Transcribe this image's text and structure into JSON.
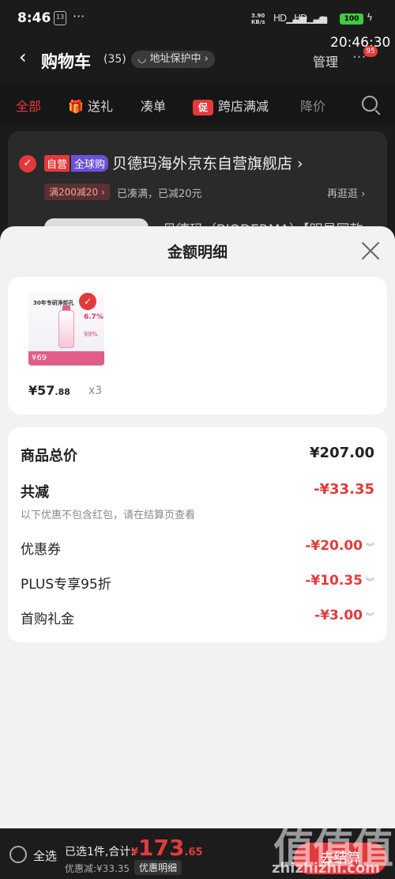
{
  "status_bar": {
    "time": "8:46",
    "notif_icon": "13",
    "more": "···",
    "speed_value": "3.90",
    "speed_unit": "KB/s",
    "signal1": "HD",
    "signal2": "HD",
    "battery": "100"
  },
  "clock_overlay": "20:46:30",
  "header": {
    "back_icon": "‹",
    "title": "购物车",
    "count": "(35)",
    "address": "地址保护中",
    "manage": "管理",
    "more_icon": "···",
    "badge": "95"
  },
  "tabs": [
    {
      "label": "全部",
      "active": true
    },
    {
      "label": "送礼",
      "icon": "gift-icon"
    },
    {
      "label": "凑单"
    },
    {
      "label": "跨店满减",
      "tag": "促"
    },
    {
      "label": "降价"
    }
  ],
  "shop": {
    "tag_self": "自营",
    "tag_global": "全球购",
    "name": "贝德玛海外京东自营旗舰店",
    "promo": "满200减20",
    "promo_status": "已凑满，已减20元",
    "more": "再逛逛",
    "product_title": "贝德玛（BIODERMA）【明星同款"
  },
  "sheet": {
    "title": "金额明细",
    "product": {
      "image_header": "30年专研净卸孔",
      "image_pct1": "6.7%",
      "image_pct2": "99%",
      "image_price": "69",
      "price_int": "¥57",
      "price_dec": ".88",
      "qty": "x3"
    },
    "summary": {
      "total_label": "商品总价",
      "total_value": "¥207.00",
      "reduce_label": "共减",
      "reduce_value": "-¥33.35",
      "note": "以下优惠不包含红包，请在结算页查看",
      "items": [
        {
          "label": "优惠券",
          "value": "-¥20.00"
        },
        {
          "label": "PLUS专享95折",
          "value": "-¥10.35"
        },
        {
          "label": "首购礼金",
          "value": "-¥3.00"
        }
      ]
    }
  },
  "bottom": {
    "select_all": "全选",
    "selected_info": "已选1件,合计:",
    "total_yen": "¥",
    "total_int": "173",
    "total_dec": ".65",
    "discount": "优惠减:¥33.35",
    "detail": "优惠明细",
    "checkout": "去结算",
    "watermark": "值值值",
    "watermark_url": "zhizhizhi.com"
  },
  "colors": {
    "accent": "#e4393c",
    "sheet_bg": "#f2f2f2"
  }
}
